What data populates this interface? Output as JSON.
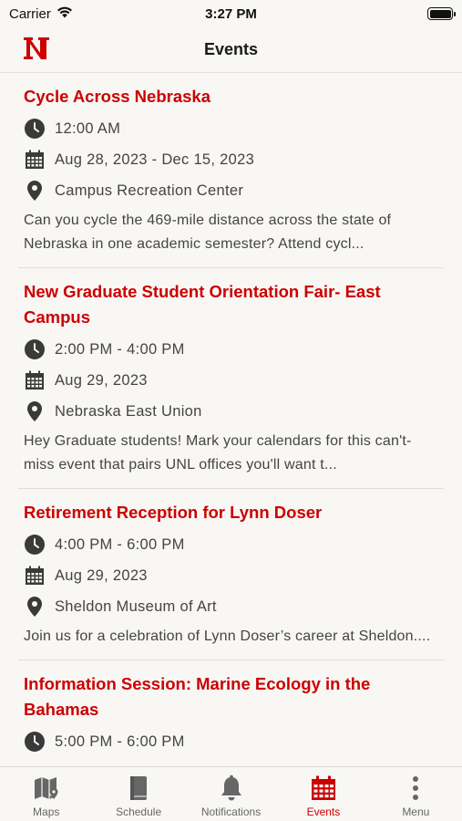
{
  "status": {
    "carrier": "Carrier",
    "time": "3:27 PM"
  },
  "header": {
    "title": "Events",
    "logo": "N"
  },
  "events": [
    {
      "title": "Cycle Across Nebraska",
      "time": "12:00 AM",
      "date": "Aug 28, 2023 - Dec 15, 2023",
      "location": "Campus Recreation Center",
      "description": "Can you cycle the 469-mile distance across the state of Nebraska in one academic semester? Attend cycl..."
    },
    {
      "title": "New Graduate Student Orientation Fair- East Campus",
      "time": "2:00 PM - 4:00 PM",
      "date": "Aug 29, 2023",
      "location": "Nebraska East Union",
      "description": "Hey Graduate students!  Mark your calendars for this can't-miss event that pairs UNL offices you'll want t..."
    },
    {
      "title": "Retirement Reception for Lynn Doser",
      "time": "4:00 PM - 6:00 PM",
      "date": "Aug 29, 2023",
      "location": "Sheldon Museum of Art",
      "description": "Join us for a celebration of Lynn Doser’s career at Sheldon...."
    },
    {
      "title": "Information Session: Marine Ecology in the Bahamas",
      "time": "5:00 PM - 6:00 PM",
      "date": "",
      "location": "",
      "description": ""
    }
  ],
  "tabs": [
    {
      "label": "Maps",
      "icon": "map-icon"
    },
    {
      "label": "Schedule",
      "icon": "book-icon"
    },
    {
      "label": "Notifications",
      "icon": "bell-icon"
    },
    {
      "label": "Events",
      "icon": "calendar-icon"
    },
    {
      "label": "Menu",
      "icon": "more-vertical-icon"
    }
  ],
  "colors": {
    "accent": "#cc0000",
    "background": "#f8f7f4",
    "text": "#444444"
  }
}
